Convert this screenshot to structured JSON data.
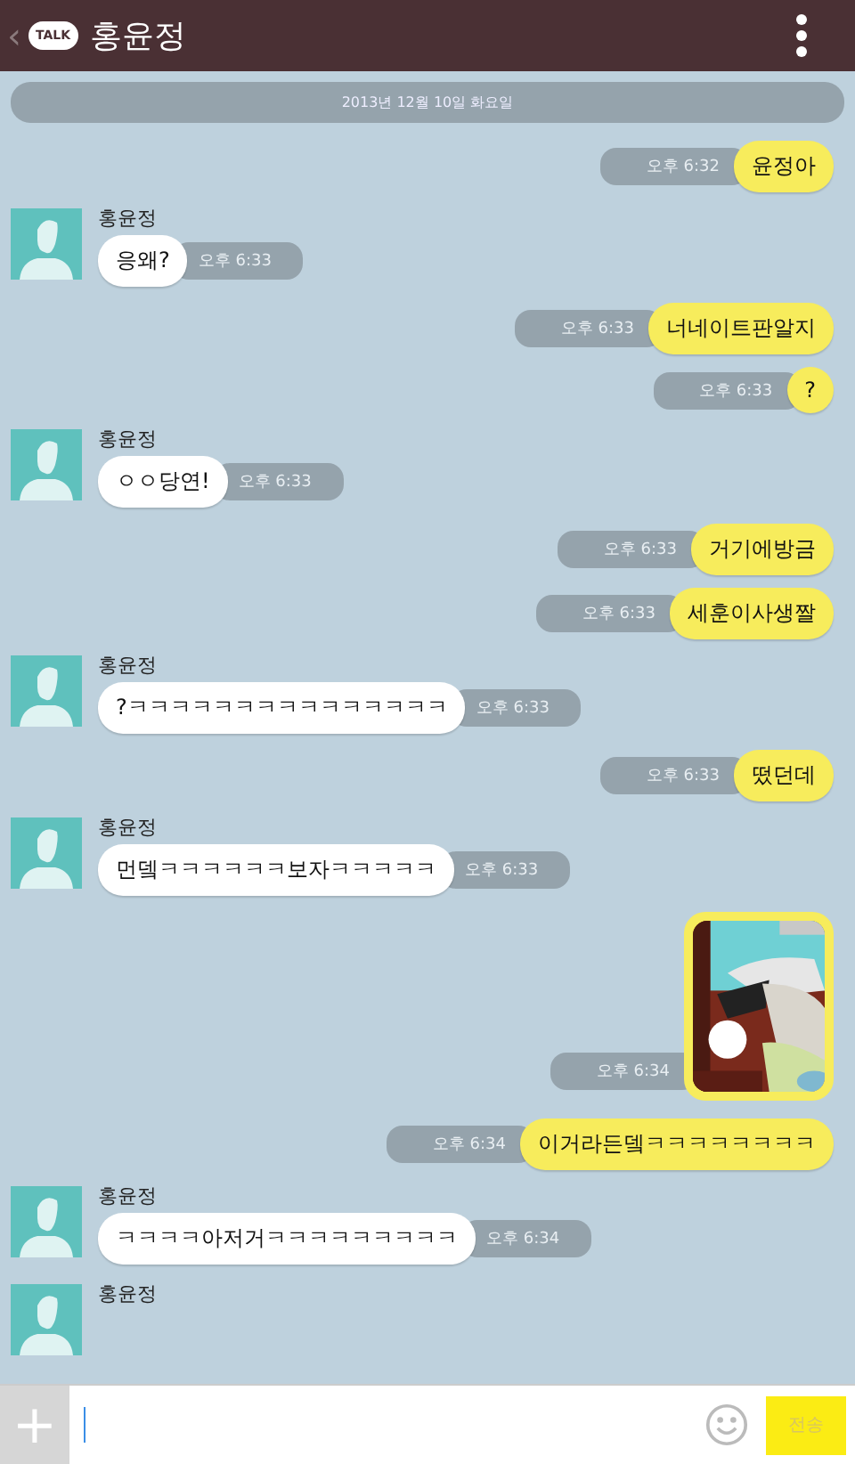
{
  "header": {
    "back": "‹",
    "logo": "TALK",
    "title": "홍윤정"
  },
  "date": "2013년 12월 10일 화요일",
  "messages": [
    {
      "kind": "sent",
      "text": "윤정아",
      "time": "오후 6:32"
    },
    {
      "kind": "received",
      "name": "홍윤정",
      "text": "응왜?",
      "time": "오후 6:33"
    },
    {
      "kind": "sent",
      "text": "너네이트판알지",
      "time": "오후 6:33"
    },
    {
      "kind": "sent",
      "text": "?",
      "time": "오후 6:33"
    },
    {
      "kind": "received",
      "name": "홍윤정",
      "text": "ㅇㅇ당연!",
      "time": "오후 6:33"
    },
    {
      "kind": "sent",
      "text": "거기에방금",
      "time": "오후 6:33"
    },
    {
      "kind": "sent",
      "text": "세훈이사생짤",
      "time": "오후 6:33"
    },
    {
      "kind": "received",
      "name": "홍윤정",
      "text": "?ㅋㅋㅋㅋㅋㅋㅋㅋㅋㅋㅋㅋㅋㅋㅋ",
      "time": "오후 6:33"
    },
    {
      "kind": "sent",
      "text": "떴던데",
      "time": "오후 6:33"
    },
    {
      "kind": "received",
      "name": "홍윤정",
      "text": "먼뎈ㅋㅋㅋㅋㅋㅋ보자ㅋㅋㅋㅋㅋ",
      "time": "오후 6:33"
    },
    {
      "kind": "sent_photo",
      "time": "오후 6:34"
    },
    {
      "kind": "sent",
      "text": "이거라든뎈ㅋㅋㅋㅋㅋㅋㅋㅋ",
      "time": "오후 6:34"
    },
    {
      "kind": "received",
      "name": "홍윤정",
      "text": "ㅋㅋㅋㅋ아저거ㅋㅋㅋㅋㅋㅋㅋㅋㅋ",
      "time": "오후 6:34"
    },
    {
      "kind": "received_cut",
      "name": "홍윤정"
    }
  ],
  "composer": {
    "plus": "+",
    "send": "전송"
  }
}
